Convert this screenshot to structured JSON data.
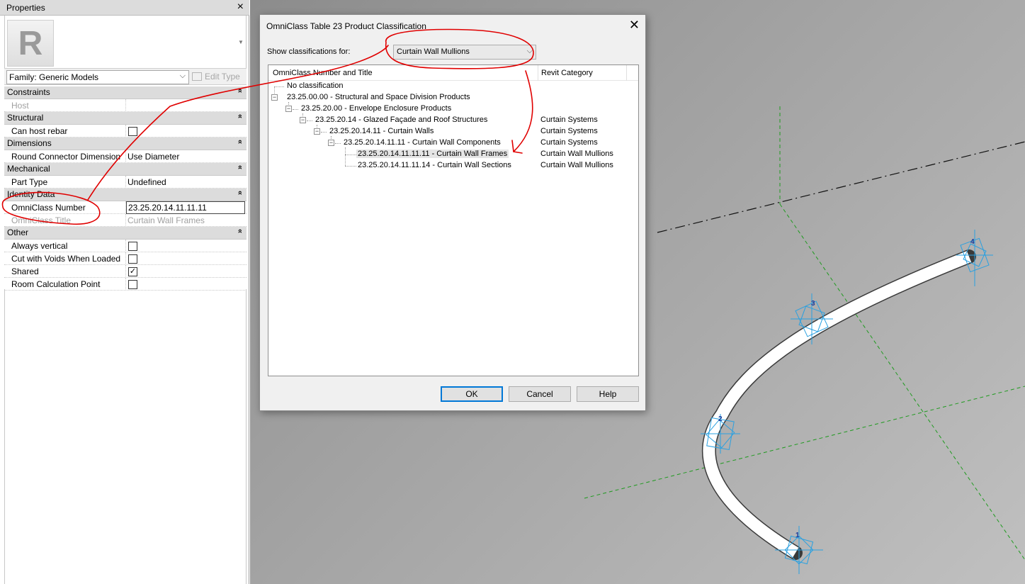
{
  "properties": {
    "title": "Properties",
    "family_select": "Family: Generic Models",
    "edit_type": "Edit Type",
    "sections": [
      {
        "name": "Constraints",
        "rows": [
          {
            "label": "Host",
            "value": "",
            "disabled": true
          }
        ]
      },
      {
        "name": "Structural",
        "rows": [
          {
            "label": "Can host rebar",
            "checkbox": false
          }
        ]
      },
      {
        "name": "Dimensions",
        "rows": [
          {
            "label": "Round Connector Dimension",
            "value": "Use Diameter"
          }
        ]
      },
      {
        "name": "Mechanical",
        "rows": [
          {
            "label": "Part Type",
            "value": "Undefined"
          }
        ]
      },
      {
        "name": "Identity Data",
        "rows": [
          {
            "label": "OmniClass Number",
            "value": "23.25.20.14.11.11.11",
            "editing": true
          },
          {
            "label": "OmniClass Title",
            "value": "Curtain Wall Frames",
            "disabled": true
          }
        ]
      },
      {
        "name": "Other",
        "rows": [
          {
            "label": "Always vertical",
            "checkbox": false
          },
          {
            "label": "Cut with Voids When Loaded",
            "checkbox": false
          },
          {
            "label": "Shared",
            "checkbox": true
          },
          {
            "label": "Room Calculation Point",
            "checkbox": false
          }
        ]
      }
    ],
    "collapse_glyph": "»"
  },
  "dialog": {
    "title": "OmniClass Table 23 Product Classification",
    "close": "✕",
    "show_label": "Show classifications for:",
    "show_value": "Curtain Wall Mullions",
    "columns": [
      "OmniClass Number and Title",
      "Revit Category"
    ],
    "tree": [
      {
        "text": "No classification",
        "category": ""
      },
      {
        "text": "23.25.00.00 - Structural and Space Division Products",
        "category": ""
      },
      {
        "text": "23.25.20.00 - Envelope Enclosure Products",
        "category": ""
      },
      {
        "text": "23.25.20.14 - Glazed Façade and Roof Structures",
        "category": "Curtain Systems"
      },
      {
        "text": "23.25.20.14.11 - Curtain Walls",
        "category": "Curtain Systems"
      },
      {
        "text": "23.25.20.14.11.11 - Curtain Wall Components",
        "category": "Curtain Systems"
      },
      {
        "text": "23.25.20.14.11.11.11 - Curtain Wall Frames",
        "category": "Curtain Wall Mullions",
        "selected": true
      },
      {
        "text": "23.25.20.14.11.11.14 - Curtain Wall Sections",
        "category": "Curtain Wall Mullions"
      }
    ],
    "buttons": {
      "ok": "OK",
      "cancel": "Cancel",
      "help": "Help"
    }
  },
  "viewport": {
    "point_labels": [
      "1",
      "2",
      "3",
      "4"
    ],
    "colors": {
      "grid": "#1f9a1f",
      "handles": "#2aa0e0",
      "annotation": "#e00000"
    }
  },
  "icons": {
    "logo_letter": "R",
    "chevron": "⌄",
    "checkmark": "✓"
  }
}
